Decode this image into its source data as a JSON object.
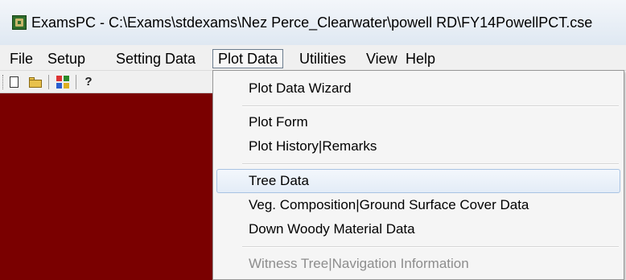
{
  "window": {
    "title": "ExamsPC - C:\\Exams\\stdexams\\Nez Perce_Clearwater\\powell RD\\FY14PowellPCT.cse",
    "icon": "app-icon"
  },
  "menubar": {
    "items": [
      {
        "label": "File"
      },
      {
        "label": "Setup"
      },
      {
        "label": "Setting Data"
      },
      {
        "label": "Plot Data"
      },
      {
        "label": "Utilities"
      },
      {
        "label": "View"
      },
      {
        "label": "Help"
      }
    ],
    "open_item": "Plot Data"
  },
  "toolbar": {
    "buttons": [
      {
        "icon": "new-file-icon"
      },
      {
        "icon": "open-folder-icon"
      },
      {
        "icon": "data-grid-icon"
      },
      {
        "icon": "help-icon",
        "glyph": "?"
      }
    ]
  },
  "workspace": {
    "background": "#7a0000"
  },
  "plot_data_menu": {
    "groups": [
      [
        {
          "label": "Plot Data Wizard",
          "enabled": true
        }
      ],
      [
        {
          "label": "Plot Form",
          "enabled": true
        },
        {
          "label": "Plot History|Remarks",
          "enabled": true
        }
      ],
      [
        {
          "label": "Tree Data",
          "enabled": true,
          "highlighted": true
        },
        {
          "label": "Veg. Composition|Ground Surface Cover Data",
          "enabled": true
        },
        {
          "label": "Down Woody Material Data",
          "enabled": true
        }
      ],
      [
        {
          "label": "Witness Tree|Navigation Information",
          "enabled": false
        }
      ]
    ]
  }
}
